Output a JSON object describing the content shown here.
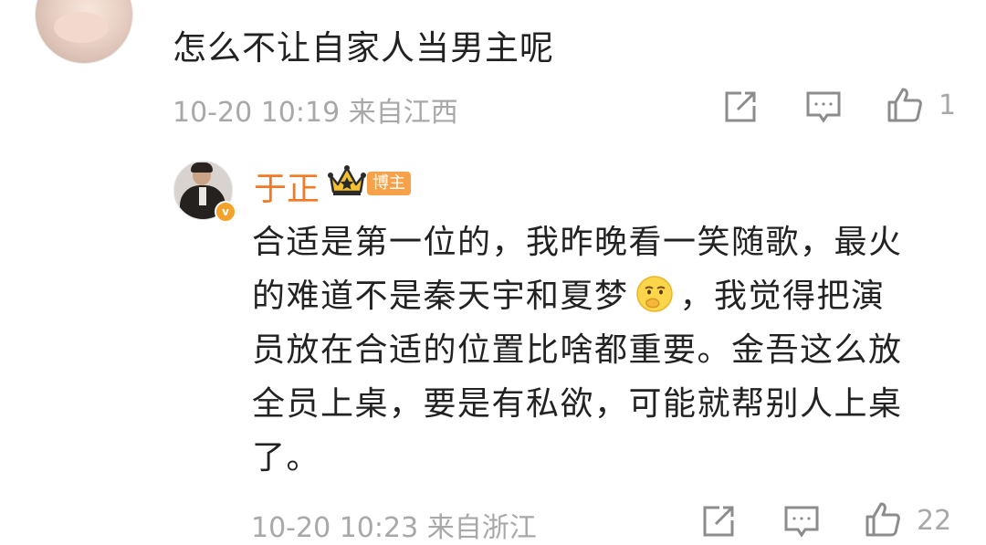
{
  "comment": {
    "text": "怎么不让自家人当男主呢",
    "meta": "10-20 10:19 来自江西",
    "like_count": "1"
  },
  "reply": {
    "username": "于正",
    "badge": "博主",
    "lines": [
      "合适是第一位的，我昨晚看一笑随歌，最火",
      "的难道不是秦天宇和夏梦",
      "，我觉得把演",
      "员放在合适的位置比啥都重要。金吾这么放",
      "全员上桌，要是有私欲，可能就帮别人上桌",
      "了。"
    ],
    "meta": "10-20 10:23 来自浙江",
    "like_count": "22"
  },
  "icons": {
    "share": "share-icon",
    "comment": "comment-icon",
    "like": "thumbs-up-icon",
    "crown": "crown-icon",
    "emoji": "thinking-emoji-icon",
    "verified": "verified-v-icon"
  },
  "colors": {
    "username": "#f27a26",
    "badge_bg": "#f7a14a",
    "meta": "#a8a8a8",
    "text": "#222222"
  }
}
